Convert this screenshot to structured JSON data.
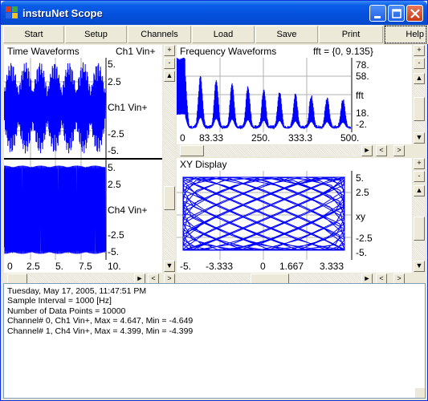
{
  "window": {
    "title": "instruNet Scope"
  },
  "toolbar": {
    "buttons": [
      "Start",
      "Setup",
      "Channels",
      "Load",
      "Save",
      "Print",
      "Help"
    ]
  },
  "time_panel": {
    "title": "Time Waveforms",
    "channel_label": "Ch1 Vin+",
    "ch1": {
      "y_ticks": [
        "5.",
        "2.5",
        "Ch1 Vin+",
        "-2.5",
        "-5."
      ]
    },
    "ch4": {
      "y_ticks": [
        "5.",
        "2.5",
        "Ch4 Vin+",
        "-2.5",
        "-5."
      ]
    },
    "x_ticks": [
      "0",
      "2.5",
      "5.",
      "7.5",
      "10."
    ],
    "line_color": "#0000FF"
  },
  "freq_panel": {
    "title": "Frequency Waveforms",
    "range_label": "fft = {0, 9.135}",
    "y_ticks": [
      "78.",
      "58.",
      "fft",
      "18.",
      "-2."
    ],
    "x_ticks": [
      "0",
      "83.33",
      "250.",
      "333.3",
      "500."
    ]
  },
  "xy_panel": {
    "title": "XY Display",
    "y_ticks": [
      "5.",
      "2.5",
      "xy",
      "-2.5",
      "-5."
    ],
    "x_ticks": [
      "-5.",
      "-3.333",
      "0",
      "1.667",
      "3.333"
    ]
  },
  "scroll_glyphs": {
    "plus": "+",
    "minus": "-",
    "up": "▲",
    "down": "▼",
    "left": "◄",
    "right": "►",
    "lt": "<",
    "gt": ">"
  },
  "info": {
    "lines": [
      "Tuesday, May 17, 2005, 11:47:51 PM",
      " Sample Interval =  1000 [Hz]",
      " Number of Data Points =  10000",
      " Channel# 0, Ch1 Vin+, Max = 4.647, Min = -4.649",
      " Channel# 1, Ch4 Vin+, Max = 4.399, Min = -4.399"
    ]
  },
  "chart_data": [
    {
      "type": "line",
      "title": "Time Waveforms",
      "series": [
        {
          "name": "Ch1 Vin+"
        }
      ],
      "xlim": [
        0,
        10
      ],
      "ylim": [
        -5,
        5
      ],
      "x_ticks": [
        0,
        2.5,
        5,
        7.5,
        10
      ],
      "y_ticks": [
        5,
        2.5,
        -2.5,
        -5
      ],
      "note_max": 4.647,
      "note_min": -4.649
    },
    {
      "type": "line",
      "series": [
        {
          "name": "Ch4 Vin+"
        }
      ],
      "xlim": [
        0,
        10
      ],
      "ylim": [
        -5,
        5
      ],
      "y_ticks": [
        5,
        2.5,
        -2.5,
        -5
      ],
      "note_max": 4.399,
      "note_min": -4.399
    },
    {
      "type": "line",
      "title": "Frequency Waveforms",
      "series": [
        {
          "name": "fft"
        }
      ],
      "xlim": [
        0,
        500
      ],
      "ylim": [
        -2,
        78
      ],
      "x_ticks": [
        0,
        83.33,
        250,
        333.3,
        500
      ],
      "y_ticks": [
        78,
        58,
        18,
        -2
      ]
    },
    {
      "type": "scatter",
      "title": "XY Display",
      "series": [
        {
          "name": "xy"
        }
      ],
      "xlim": [
        -5,
        5
      ],
      "ylim": [
        -5,
        5
      ],
      "x_ticks": [
        -5,
        -3.333,
        0,
        1.667,
        3.333
      ],
      "y_ticks": [
        5,
        2.5,
        -2.5,
        -5
      ]
    }
  ]
}
